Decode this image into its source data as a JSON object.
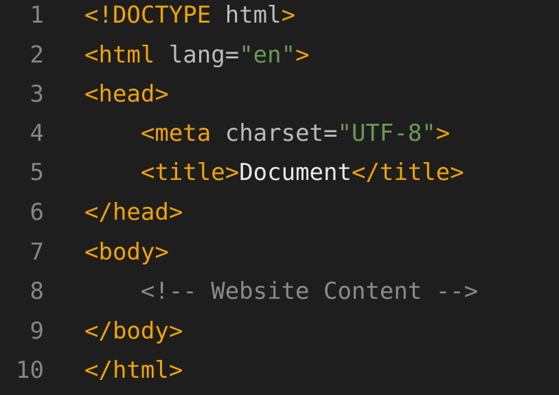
{
  "editor": {
    "lines": [
      {
        "number": "1",
        "tokens": [
          {
            "t": "tag",
            "v": "<!DOCTYPE"
          },
          {
            "t": "attr",
            "v": " html"
          },
          {
            "t": "tag",
            "v": ">"
          }
        ]
      },
      {
        "number": "2",
        "tokens": [
          {
            "t": "tag",
            "v": "<html"
          },
          {
            "t": "attr",
            "v": " lang="
          },
          {
            "t": "str",
            "v": "\"en\""
          },
          {
            "t": "tag",
            "v": ">"
          }
        ]
      },
      {
        "number": "3",
        "tokens": [
          {
            "t": "tag",
            "v": "<head>"
          }
        ]
      },
      {
        "number": "4",
        "tokens": [
          {
            "t": "txt",
            "v": "    "
          },
          {
            "t": "tag",
            "v": "<meta"
          },
          {
            "t": "attr",
            "v": " charset="
          },
          {
            "t": "str",
            "v": "\"UTF-8\""
          },
          {
            "t": "tag",
            "v": ">"
          }
        ]
      },
      {
        "number": "5",
        "tokens": [
          {
            "t": "txt",
            "v": "    "
          },
          {
            "t": "tag",
            "v": "<title>"
          },
          {
            "t": "txt",
            "v": "Document"
          },
          {
            "t": "tag",
            "v": "</title>"
          }
        ]
      },
      {
        "number": "6",
        "tokens": [
          {
            "t": "tag",
            "v": "</head>"
          }
        ]
      },
      {
        "number": "7",
        "tokens": [
          {
            "t": "tag",
            "v": "<body>"
          }
        ]
      },
      {
        "number": "8",
        "tokens": [
          {
            "t": "txt",
            "v": "    "
          },
          {
            "t": "cmt",
            "v": "<!-- Website Content -->"
          }
        ]
      },
      {
        "number": "9",
        "tokens": [
          {
            "t": "tag",
            "v": "</body>"
          }
        ]
      },
      {
        "number": "10",
        "tokens": [
          {
            "t": "tag",
            "v": "</html>"
          }
        ]
      }
    ]
  },
  "colors": {
    "background": "#1e1e1e",
    "line_number": "#858585",
    "tag": "#f0a30a",
    "attribute": "#bcbcbc",
    "string": "#6a9955",
    "text": "#e8e8e8",
    "comment": "#8a8a8a"
  }
}
